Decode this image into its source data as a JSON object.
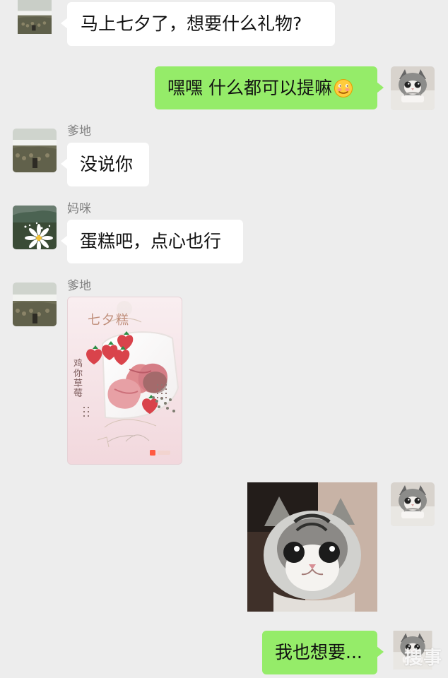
{
  "conversation": {
    "messages": [
      {
        "side": "left",
        "sender": "",
        "text": "马上七夕了，想要什么礼物?",
        "avatar": "landscape-avatar-icon"
      },
      {
        "side": "right",
        "sender": "",
        "text": "嘿嘿 什么都可以提嘛",
        "emoji": "smirk-face-icon",
        "avatar": "cat-avatar-icon"
      },
      {
        "side": "left",
        "sender": "爹地",
        "text": "没说你",
        "avatar": "landscape-avatar-icon"
      },
      {
        "side": "left",
        "sender": "妈咪",
        "text": "蛋糕吧，点心也行",
        "avatar": "flower-avatar-icon"
      },
      {
        "side": "left",
        "sender": "爹地",
        "text": "",
        "image": "poster-image",
        "avatar": "landscape-avatar-icon"
      },
      {
        "side": "right",
        "sender": "",
        "text": "",
        "image": "cat-photo",
        "avatar": "cat-avatar-icon"
      },
      {
        "side": "right",
        "sender": "",
        "text": "我也想要...",
        "avatar": "cat-avatar-icon"
      }
    ]
  },
  "poster": {
    "script_title": "七夕糕",
    "side_text": "鸡你草莓"
  },
  "watermark": {
    "text": "搜事"
  },
  "colors": {
    "background": "#ededed",
    "right_bubble": "#95ec69",
    "left_bubble": "#ffffff",
    "name_text": "#7f7f7f"
  }
}
